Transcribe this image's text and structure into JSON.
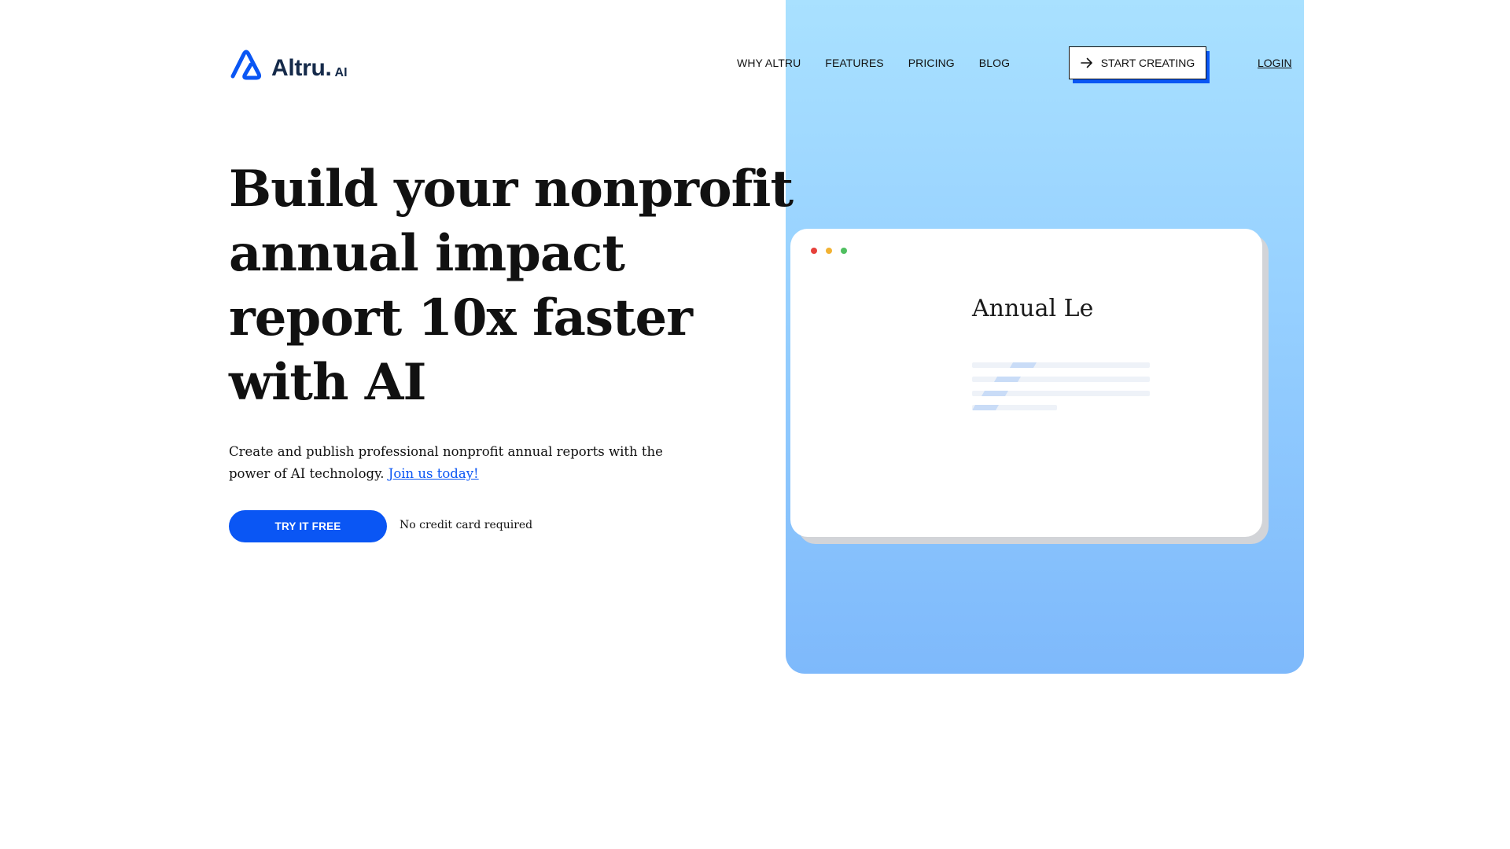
{
  "brand": {
    "name": "Altru.",
    "suffix": "AI",
    "primary_color": "#0a56f4",
    "logo_color": "#152a4a"
  },
  "nav": {
    "items": [
      {
        "label": "WHY ALTRU"
      },
      {
        "label": "FEATURES"
      },
      {
        "label": "PRICING"
      },
      {
        "label": "BLOG"
      }
    ],
    "cta": {
      "label": "START CREATING",
      "icon": "arrow-right-icon"
    },
    "login": {
      "label": "LOGIN"
    }
  },
  "hero": {
    "headline_lines": [
      "Build your nonprofit",
      "annual impact",
      "report 10x faster",
      "with AI"
    ],
    "subcopy": "Create and publish professional nonprofit annual reports with the power of AI technology.",
    "link_text": "Join us today!",
    "cta_label": "TRY IT FREE",
    "note": "No credit card required"
  },
  "mockup": {
    "title": "Annual Le",
    "window_dots": [
      "#e6413b",
      "#f2b233",
      "#4fbf60"
    ],
    "panel_gradient": [
      "#a9e1ff",
      "#7eb9fb"
    ]
  }
}
